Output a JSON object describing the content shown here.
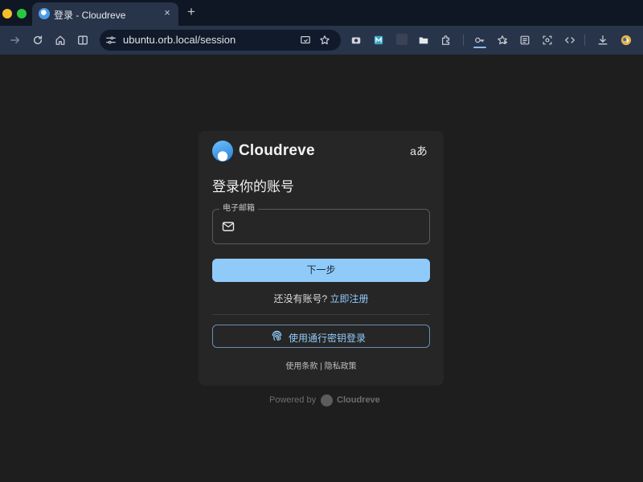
{
  "browser": {
    "tab_title": "登录 - Cloudreve",
    "tab_close": "×",
    "new_tab": "+",
    "url": "ubuntu.orb.local/session"
  },
  "colors": {
    "accent": "#90caf9",
    "page_background": "#1e1e1e",
    "card_background": "#262626",
    "chrome_background": "#27344a"
  },
  "brand": {
    "name": "Cloudreve",
    "language_button": "aあ"
  },
  "login": {
    "title": "登录你的账号",
    "email_label": "电子邮箱",
    "email_value": "",
    "next_button": "下一步",
    "no_account_text": "还没有账号?",
    "signup_link": "立即注册",
    "passkey_button": "使用通行密钥登录",
    "terms_link": "使用条款",
    "legal_separator": " | ",
    "privacy_link": "隐私政策"
  },
  "footer": {
    "powered_by": "Powered by",
    "brand": "Cloudreve"
  }
}
